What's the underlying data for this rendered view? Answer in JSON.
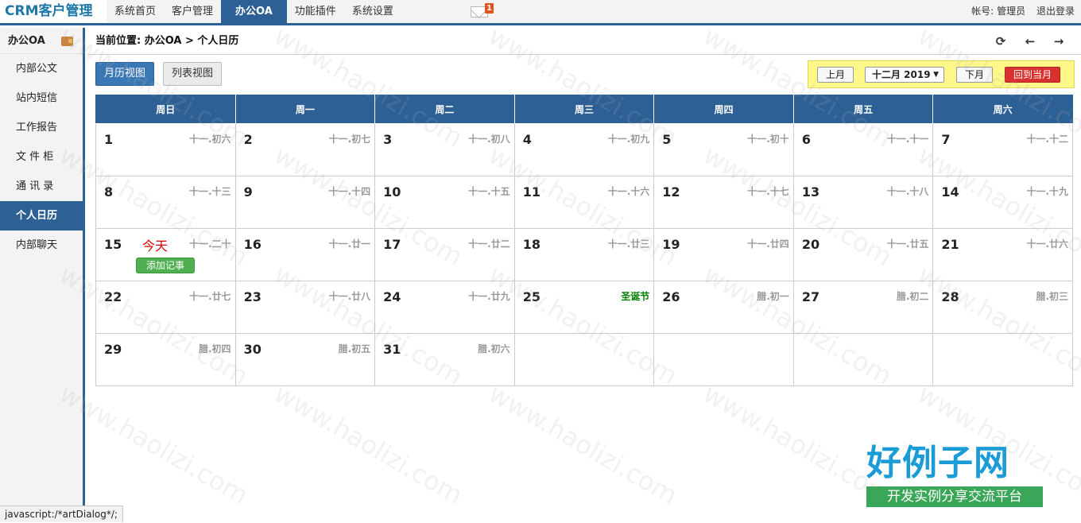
{
  "app": {
    "title": "CRM客户管理"
  },
  "nav": {
    "items": [
      "系统首页",
      "客户管理",
      "办公OA",
      "功能插件",
      "系统设置"
    ],
    "active_index": 2,
    "mail_count": "1"
  },
  "account": {
    "label": "帐号:",
    "user": "管理员",
    "logout": "退出登录"
  },
  "sidebar": {
    "title": "办公OA",
    "items": [
      "内部公文",
      "站内短信",
      "工作报告",
      "文 件 柜",
      "通 讯 录",
      "个人日历",
      "内部聊天"
    ],
    "active_index": 5
  },
  "breadcrumb": "当前位置: 办公OA > 个人日历",
  "views": {
    "month": "月历视图",
    "list": "列表视图"
  },
  "month_nav": {
    "prev": "上月",
    "current": "十二月 2019",
    "next": "下月",
    "today": "回到当月"
  },
  "calendar": {
    "weekdays": [
      "周日",
      "周一",
      "周二",
      "周三",
      "周四",
      "周五",
      "周六"
    ],
    "today_label": "今天",
    "add_event": "添加记事",
    "weeks": [
      [
        {
          "d": "1",
          "l": "十一.初六"
        },
        {
          "d": "2",
          "l": "十一.初七"
        },
        {
          "d": "3",
          "l": "十一.初八"
        },
        {
          "d": "4",
          "l": "十一.初九"
        },
        {
          "d": "5",
          "l": "十一.初十"
        },
        {
          "d": "6",
          "l": "十一.十一"
        },
        {
          "d": "7",
          "l": "十一.十二"
        }
      ],
      [
        {
          "d": "8",
          "l": "十一.十三"
        },
        {
          "d": "9",
          "l": "十一.十四"
        },
        {
          "d": "10",
          "l": "十一.十五"
        },
        {
          "d": "11",
          "l": "十一.十六"
        },
        {
          "d": "12",
          "l": "十一.十七"
        },
        {
          "d": "13",
          "l": "十一.十八"
        },
        {
          "d": "14",
          "l": "十一.十九"
        }
      ],
      [
        {
          "d": "15",
          "l": "十一.二十",
          "today": true
        },
        {
          "d": "16",
          "l": "十一.廿一"
        },
        {
          "d": "17",
          "l": "十一.廿二"
        },
        {
          "d": "18",
          "l": "十一.廿三"
        },
        {
          "d": "19",
          "l": "十一.廿四"
        },
        {
          "d": "20",
          "l": "十一.廿五"
        },
        {
          "d": "21",
          "l": "十一.廿六"
        }
      ],
      [
        {
          "d": "22",
          "l": "十一.廿七"
        },
        {
          "d": "23",
          "l": "十一.廿八"
        },
        {
          "d": "24",
          "l": "十一.廿九"
        },
        {
          "d": "25",
          "l": "圣诞节",
          "holiday": true
        },
        {
          "d": "26",
          "l": "腊.初一"
        },
        {
          "d": "27",
          "l": "腊.初二"
        },
        {
          "d": "28",
          "l": "腊.初三"
        }
      ],
      [
        {
          "d": "29",
          "l": "腊.初四"
        },
        {
          "d": "30",
          "l": "腊.初五"
        },
        {
          "d": "31",
          "l": "腊.初六"
        },
        {
          "d": "",
          "l": ""
        },
        {
          "d": "",
          "l": ""
        },
        {
          "d": "",
          "l": ""
        },
        {
          "d": "",
          "l": ""
        }
      ]
    ]
  },
  "watermark": {
    "text": "www.haolizi.com",
    "brand": "好例子网",
    "brand_sub": "开发实例分享交流平台"
  },
  "status_bar": "javascript:/*artDialog*/;",
  "colors": {
    "primary": "#2d6094",
    "today_red": "#d40000",
    "holiday_green": "#008000",
    "add_green": "#4fae4f"
  }
}
